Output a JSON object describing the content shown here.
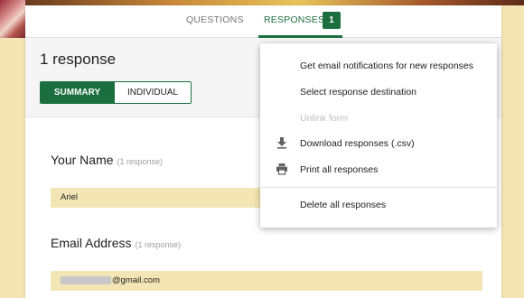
{
  "tabs": [
    {
      "label": "QUESTIONS"
    },
    {
      "label": "RESPONSES",
      "badge": "1"
    }
  ],
  "summary": {
    "title": "1 response",
    "toggle": {
      "summary_label": "SUMMARY",
      "individual_label": "INDIVIDUAL"
    }
  },
  "questions": [
    {
      "label": "Your Name",
      "count": "(1 response)",
      "answer": "Ariel"
    },
    {
      "label": "Email Address",
      "count": "(1 response)",
      "answer_suffix": "@gmail.com"
    }
  ],
  "menu": {
    "items": [
      {
        "label": "Get email notifications for new responses"
      },
      {
        "label": "Select response destination"
      },
      {
        "label": "Unlink form",
        "disabled": true
      },
      {
        "label": "Download responses (.csv)",
        "icon": "download-icon"
      },
      {
        "label": "Print all responses",
        "icon": "print-icon"
      },
      {
        "label": "Delete all responses"
      }
    ]
  },
  "colors": {
    "accent": "#1b6e3f",
    "background": "#f3e6b4"
  }
}
